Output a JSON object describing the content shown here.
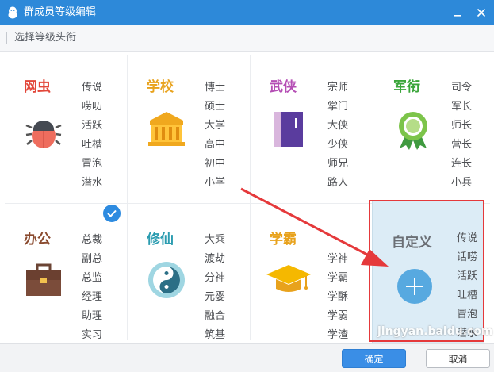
{
  "window": {
    "title": "群成员等级编辑"
  },
  "toolbar": {
    "label": "选择等级头衔"
  },
  "colors": {
    "titlebar": "#2d89d9",
    "accent": "#3a8ee6",
    "highlight_box": "#e5393b"
  },
  "categories": [
    {
      "name": "网虫",
      "color": "#e2473a",
      "icon": "bug-icon",
      "titles": [
        "传说",
        "唠叨",
        "活跃",
        "吐槽",
        "冒泡",
        "潜水"
      ]
    },
    {
      "name": "学校",
      "color": "#e8a21c",
      "icon": "school-building-icon",
      "titles": [
        "博士",
        "硕士",
        "大学",
        "高中",
        "初中",
        "小学"
      ]
    },
    {
      "name": "武侠",
      "color": "#b54fb5",
      "icon": "book-icon",
      "titles": [
        "宗师",
        "掌门",
        "大侠",
        "少侠",
        "师兄",
        "路人"
      ]
    },
    {
      "name": "军衔",
      "color": "#3aa53a",
      "icon": "medal-icon",
      "titles": [
        "司令",
        "军长",
        "师长",
        "营长",
        "连长",
        "小兵"
      ]
    },
    {
      "name": "办公",
      "color": "#8a4a2e",
      "icon": "briefcase-icon",
      "titles": [
        "总裁",
        "副总",
        "总监",
        "经理",
        "助理",
        "实习"
      ]
    },
    {
      "name": "修仙",
      "color": "#2b9cb0",
      "icon": "yin-yang-icon",
      "titles": [
        "大乘",
        "渡劫",
        "分神",
        "元婴",
        "融合",
        "筑基"
      ]
    },
    {
      "name": "学霸",
      "color": "#e8a21c",
      "icon": "graduation-cap-icon",
      "titles": [
        "",
        "学神",
        "学霸",
        "学酥",
        "学弱",
        "学渣"
      ]
    }
  ],
  "custom": {
    "name": "自定义",
    "icon": "plus-icon",
    "titles": [
      "传说",
      "话唠",
      "活跃",
      "吐槽",
      "冒泡",
      "潜水"
    ]
  },
  "buttons": {
    "ok": "确定",
    "cancel": "取消"
  },
  "watermark": "jingyan.baidu.com"
}
